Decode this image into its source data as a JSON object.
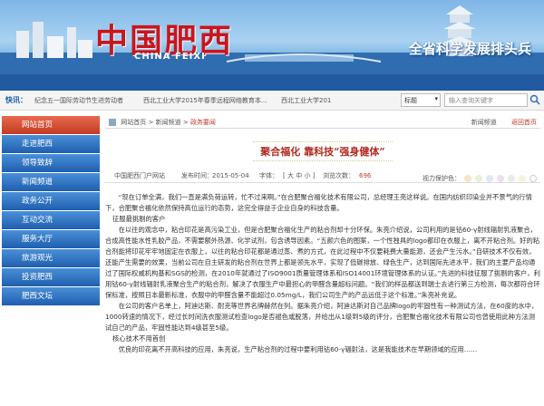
{
  "banner": {
    "title": "中国肥西",
    "title_en": "CHINA FEIXI",
    "slogan": "全省科学发展排头兵"
  },
  "quickbar": {
    "label": "快讯：",
    "news": [
      "纪念五一国际劳动节生进劳动者",
      "西北工业大学2015年春季远程网络教育本...",
      "西北工业大学201"
    ],
    "select_value": "标题",
    "search_placeholder": "输入查询关键字"
  },
  "sidebar": {
    "items": [
      "网站首页",
      "走进肥西",
      "领导致辞",
      "新闻频道",
      "政务公开",
      "互动交流",
      "服务大厅",
      "旅游观光",
      "投资肥西",
      "肥西文坛"
    ]
  },
  "breadcrumb": {
    "items": [
      "网站首页",
      "新闻频道",
      "政务要闻"
    ],
    "sep": ">",
    "links": [
      "新闻频道",
      "返回首页"
    ]
  },
  "article": {
    "title": "聚合福化 靠科技“强身健体”",
    "source": "中国肥西门户网站",
    "published_label": "发布时间：",
    "published": "2015-05-04",
    "font_label": "字体：",
    "font_sizes": [
      "大",
      "中",
      "小"
    ],
    "views_label": "浏览次数：",
    "views": "696",
    "vision_label": "视力保护色：",
    "paragraphs": [
      "“现在订单全满，我们一直是满负荷运转，忙不过来啊。”在合肥聚合福化技术有限公司，总经理王亮这样说。在国内纺织印染业并不景气的行情下，合肥聚合福化依然保持高位运行的态势，这完全得益于企业自身的科技含量。",
      "征服最挑剔的客户",
      "在以往的观念中，粘合印花是高污染工业，但是合肥聚合福化生产的粘合剂却十分环保。朱亮介绍说，公司利用的是钴60-γ射线辐射乳液聚合，合成高性能水性乳胶产品，不需要额外热源、化学试剂，包含诱导因素。“五颜六色的图案，一个性独具的logo都印在衣服上，离不开粘合剂。好的粘合剂能将印花牢牢地固定在衣服上，以往的粘合印花都是通过蒸、煮的方式，在此过程中不仅要耗费大量能源，还会产生污水。”自研技术不仅有效，还能产生需要的效果，当前公司在自主研发的粘合剂在世界上都是领先水平，实现了低碳排放、绿色生产，达到国际先进水平，我们的主要产品均通过了国际权威机构基和SGS的检测，在2010年就通过了ISO9001质量管理体系和ISO14001环境管理体系的认证。”先进的科技征服了挑剔的客户，利用钴60-γ射线辐射乳液聚合生产的粘合剂，解决了衣服生产中最担心的甲醛含量超标问题。“我们的样品都送到瑞士去进行第三方检测，每次都符合环保标准，按照日本最新标准，衣服中的甲醛含量不能超过0.05mg/L，我们公司生产的产品远低于这个标准。”朱亮补充说。",
      "在公司的客户名单上，阿迪达斯、耐克等世界名牌赫然在列。据朱亮介绍，阿迪达斯对自己品牌logo的牢固性有一种测试方法，在60度的水中，1000转速的情况下，经过长时间洗衣服测试检查logo是否褪色或脱落，并给出从1级到5级的评分，合肥聚合福化技术有限公司也曾使用此种方法测试自己的产品，牢固性能达到4级甚至5级。",
      "核心技术不用首创",
      "优良的印花离不开高科技的应用，朱亮说，生产粘合剂的过程中要利用钴60-γ辐射法，这是我能技术在早期领域的应用……"
    ]
  },
  "colors": {
    "accent_red": "#c0392b",
    "sidebar_blue": "#1f5fae",
    "sidebar_active": "#c23b22",
    "vision_colors": [
      "#f5e6c8",
      "#e7f2d6",
      "#dde9f6",
      "#ece0f0",
      "#eaeaea",
      "#f6f3d8",
      "#ffffff"
    ]
  }
}
